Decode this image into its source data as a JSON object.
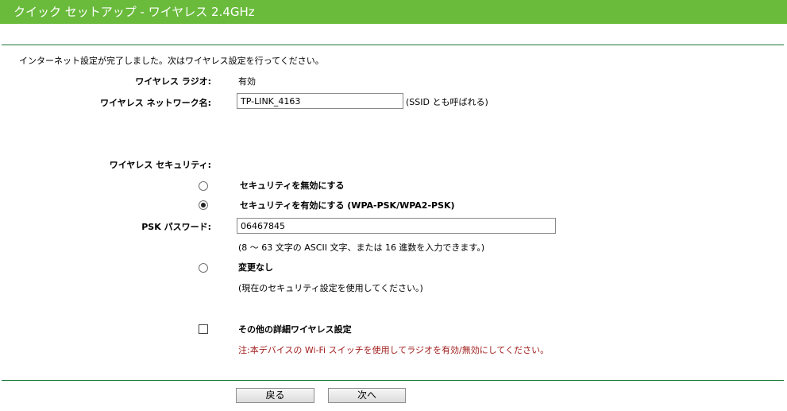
{
  "header": {
    "title": "クイック セットアップ - ワイヤレス 2.4GHz"
  },
  "intro": "インターネット設定が完了しました。次はワイヤレス設定を行ってください。",
  "wireless_radio": {
    "label": "ワイヤレス ラジオ:",
    "value": "有効"
  },
  "network_name": {
    "label": "ワイヤレス ネットワーク名:",
    "value": "TP-LINK_4163",
    "hint": "(SSID とも呼ばれる)"
  },
  "security": {
    "label": "ワイヤレス セキュリティ:",
    "disable_label": "セキュリティを無効にする",
    "enable_label": "セキュリティを有効にする (WPA-PSK/WPA2-PSK)",
    "psk_label": "PSK パスワード:",
    "psk_value": "06467845",
    "psk_hint": "(8 ～ 63 文字の ASCII 文字、または 16 進数を入力できます。)",
    "nochange_label": "変更なし",
    "nochange_hint": "(現在のセキュリティ設定を使用してください。)",
    "selected": "enable"
  },
  "advanced": {
    "label": "その他の詳細ワイヤレス設定",
    "checked": false
  },
  "note": "注:本デバイスの Wi-Fi スイッチを使用してラジオを有効/無効にしてください。",
  "buttons": {
    "back": "戻る",
    "next": "次へ"
  },
  "colors": {
    "header": "#6abb3c",
    "rule": "#1b7a3c",
    "note": "#a11d1d"
  }
}
